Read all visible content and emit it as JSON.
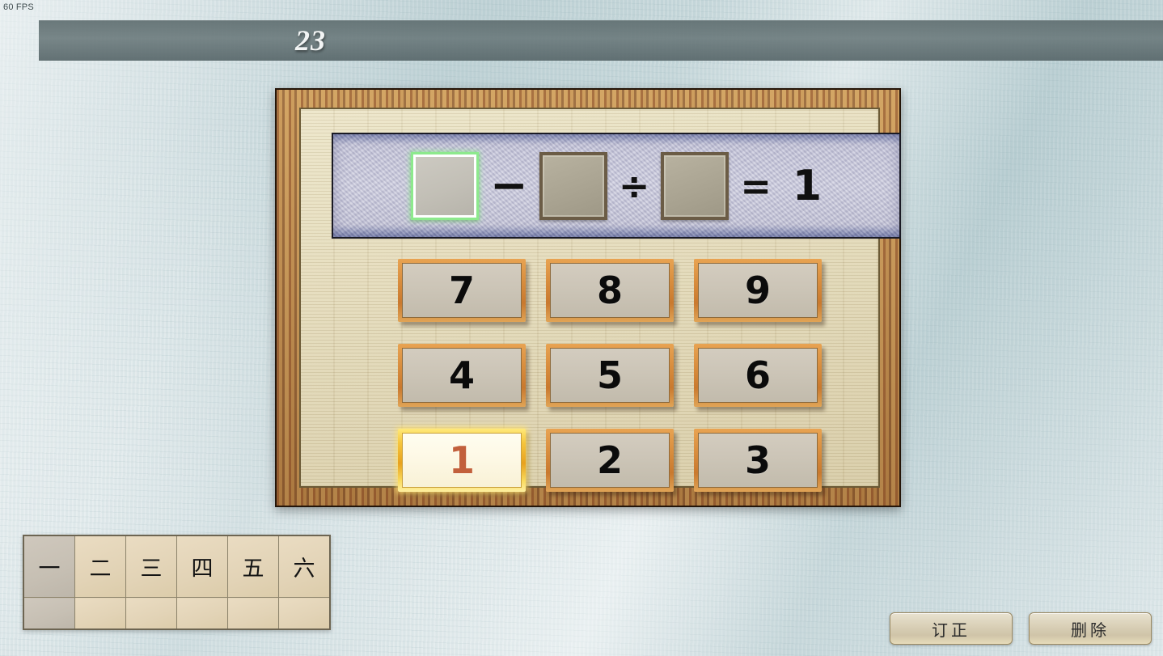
{
  "hud": {
    "fps": "60 FPS"
  },
  "titlebar": {
    "level": "23"
  },
  "equation": {
    "slots": [
      {
        "name": "slot-1",
        "value": "",
        "selected": true
      },
      {
        "name": "slot-2",
        "value": "",
        "selected": false
      },
      {
        "name": "slot-3",
        "value": "",
        "selected": false
      }
    ],
    "operator_1": "−",
    "operator_2": "÷",
    "equals": "=",
    "result": "1"
  },
  "keypad": {
    "rows": [
      [
        {
          "label": "7",
          "selected": false
        },
        {
          "label": "8",
          "selected": false
        },
        {
          "label": "9",
          "selected": false
        }
      ],
      [
        {
          "label": "4",
          "selected": false
        },
        {
          "label": "5",
          "selected": false
        },
        {
          "label": "6",
          "selected": false
        }
      ],
      [
        {
          "label": "1",
          "selected": true
        },
        {
          "label": "2",
          "selected": false
        },
        {
          "label": "3",
          "selected": false
        }
      ]
    ]
  },
  "char_table": {
    "header": [
      "一",
      "二",
      "三",
      "四",
      "五",
      "六"
    ],
    "body": [
      "",
      "",
      "",
      "",
      "",
      ""
    ],
    "highlight_column": 0
  },
  "actions": {
    "correct_label": "订正",
    "delete_label": "删除"
  },
  "colors": {
    "background": "#cfdde0",
    "titlebar": "#69787a",
    "panel_frame": "#b98b4e",
    "board": "#d9cfae",
    "equation_strip": "#c3c3d8",
    "key_border": "#d98e3e",
    "key_face": "#cbc4b6",
    "selected_key_glow": "#f6c63d",
    "selected_key_text": "#c2603c",
    "selected_slot_outline": "#8de98d"
  }
}
